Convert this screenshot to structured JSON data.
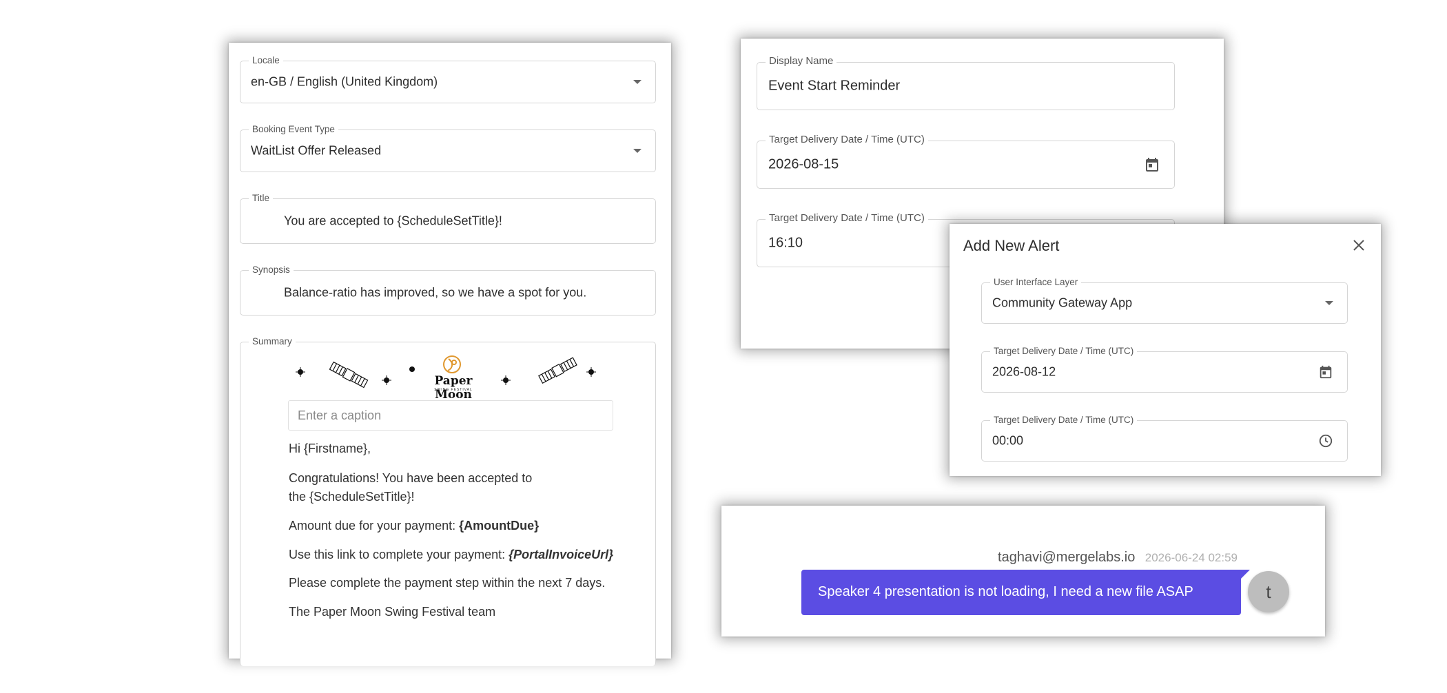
{
  "left_form": {
    "locale": {
      "label": "Locale",
      "value": "en-GB / English (United Kingdom)"
    },
    "event_type": {
      "label": "Booking Event Type",
      "value": "WaitList Offer Released"
    },
    "title": {
      "label": "Title",
      "value": "You are accepted to {ScheduleSetTitle}!"
    },
    "synopsis": {
      "label": "Synopsis",
      "value": "Balance-ratio has improved, so we have a spot for you."
    },
    "summary": {
      "label": "Summary",
      "logo_text": "Paper Moon",
      "logo_subtext": "SWING FESTIVAL",
      "caption_placeholder": "Enter a caption",
      "greeting": "Hi {Firstname},",
      "congrats_line1": "Congratulations! You have been accepted to",
      "congrats_line2": "the {ScheduleSetTitle}!",
      "amount_prefix": "Amount due for your payment: ",
      "amount_token": "{AmountDue}",
      "link_prefix": "Use this link to complete your payment: ",
      "link_token": "{PortalInvoiceUrl}",
      "deadline": "Please complete the payment step within the next 7 days.",
      "signoff": "The Paper Moon Swing Festival team"
    }
  },
  "reminder_form": {
    "display_name": {
      "label": "Display Name",
      "value": "Event Start Reminder"
    },
    "date": {
      "label": "Target Delivery Date / Time (UTC)",
      "value": "2026-08-15"
    },
    "time": {
      "label": "Target Delivery Date / Time (UTC)",
      "value": "16:10"
    }
  },
  "alert_dialog": {
    "title": "Add New Alert",
    "ui_layer": {
      "label": "User Interface Layer",
      "value": "Community Gateway App"
    },
    "date": {
      "label": "Target Delivery Date / Time (UTC)",
      "value": "2026-08-12"
    },
    "time": {
      "label": "Target Delivery Date / Time (UTC)",
      "value": "00:00"
    }
  },
  "chat": {
    "sender": "taghavi@mergelabs.io",
    "timestamp": "2026-06-24 02:59",
    "message": "Speaker 4 presentation is not loading, I need a new file ASAP",
    "avatar_initial": "t"
  },
  "colors": {
    "accent": "#5b4de3",
    "logo_orange": "#e0982f",
    "avatar_bg": "#bdbdbd"
  }
}
